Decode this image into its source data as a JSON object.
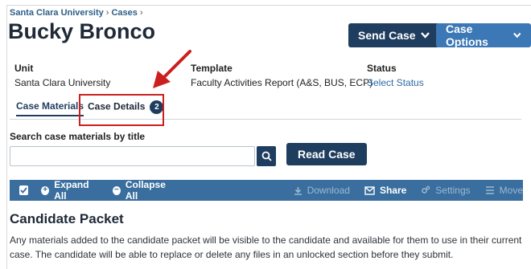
{
  "breadcrumb": {
    "items": [
      "Santa Clara University",
      "Cases"
    ],
    "trailing_sep": "›"
  },
  "page": {
    "title": "Bucky Bronco"
  },
  "header_buttons": {
    "send_case": "Send Case",
    "case_options": "Case Options"
  },
  "meta": {
    "unit_label": "Unit",
    "unit_value": "Santa Clara University",
    "template_label": "Template",
    "template_value": "Faculty Activities Report (A&S, BUS, ECP)",
    "status_label": "Status",
    "status_value": "Select Status"
  },
  "tabs": [
    {
      "label": "Case Materials"
    },
    {
      "label": "Case Details",
      "badge": "2"
    }
  ],
  "search": {
    "label": "Search case materials by title",
    "placeholder": ""
  },
  "read_case_label": "Read Case",
  "toolbar": {
    "expand_all": "Expand All",
    "collapse_all": "Collapse All",
    "download": "Download",
    "share": "Share",
    "settings": "Settings",
    "move": "Move"
  },
  "candidate_packet": {
    "title": "Candidate Packet",
    "description": "Any materials added to the candidate packet will be visible to the candidate and available for them to use in their current case. The candidate will be able to replace or delete any files in an unlocked section before they submit."
  },
  "colors": {
    "primary": "#1f3d5f",
    "accent": "#3b78b5",
    "toolbar": "#3a6e9e",
    "highlight": "#cc1f1f"
  }
}
